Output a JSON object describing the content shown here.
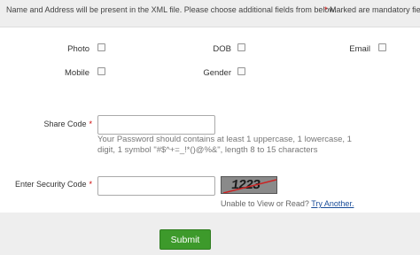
{
  "header": {
    "info_text": "Name and Address will be present in the XML file. Please choose additional fields from below.",
    "mandatory_star": "*",
    "mandatory_text": "Marked are mandatory fields"
  },
  "optional_fields": {
    "photo": "Photo",
    "dob": "DOB",
    "email": "Email",
    "mobile": "Mobile",
    "gender": "Gender"
  },
  "share_code": {
    "label": "Share Code",
    "required": "*",
    "value": "",
    "hint": "Your Password should contains at least 1 uppercase, 1 lowercase, 1 digit, 1 symbol \"#$^+=_!*()@%&\", length 8 to 15 characters"
  },
  "security_code": {
    "label": "Enter Security Code",
    "required": "*",
    "value": "",
    "captcha_text": "1223",
    "help_text": "Unable to View or Read?",
    "try_another": "Try Another."
  },
  "submit_label": "Submit",
  "colors": {
    "submit_bg": "#3d9a2b",
    "required_star": "#cc0000",
    "link": "#1a4d99",
    "bar_bg": "#eeeeee"
  }
}
